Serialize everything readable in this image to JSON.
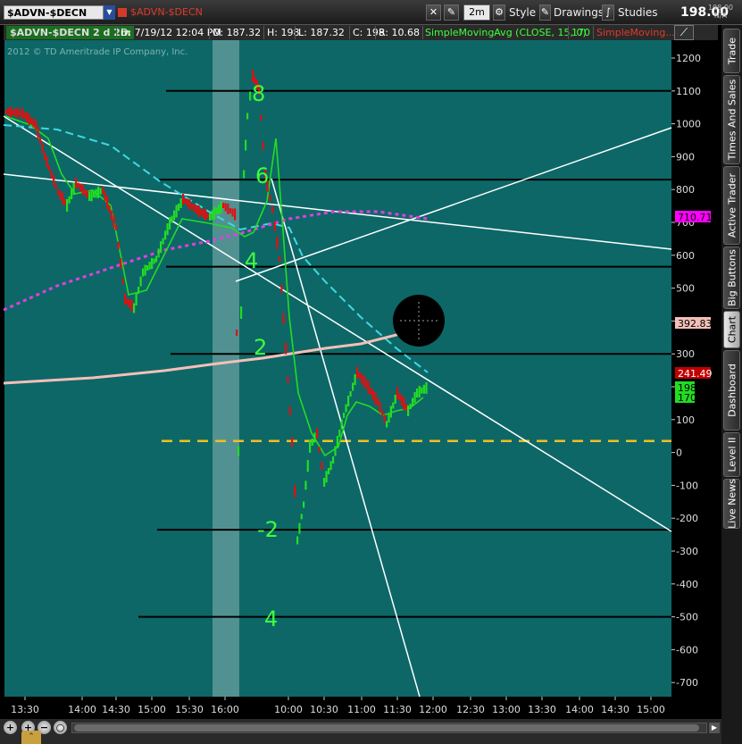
{
  "toolbar": {
    "symbol": "$ADVN-$DECN",
    "title_symbol": "$ADVN-$DECN",
    "timeframe": "2m",
    "style": "Style",
    "drawings": "Drawings",
    "studies": "Studies",
    "last_price": "198.00",
    "last_price_small": "198.00",
    "last_price_na": "N/A"
  },
  "infobar": {
    "symbol_period": "$ADVN-$DECN 2 d 2m",
    "datetime": "D: 7/19/12 12:04 PM",
    "open": "O: 187.32",
    "high": "H: 198",
    "low": "L: 187.32",
    "close": "C: 198",
    "range": "R: 10.68",
    "study": "SimpleMovingAvg (CLOSE, 15, 0)",
    "study_value": "170",
    "study2": "SimpleMoving..."
  },
  "chart": {
    "watermark": "2012 © TD Ameritrade IP Company, Inc.",
    "background": "#0d6767",
    "y_ticks": [
      "1200",
      "1100",
      "1000",
      "900",
      "800",
      "700",
      "600",
      "500",
      "400",
      "300",
      "200",
      "100",
      "0",
      "-100",
      "-200",
      "-300",
      "-400",
      "-500",
      "-600",
      "-700"
    ],
    "x_ticks": [
      "13:30",
      "14:00",
      "14:30",
      "15:00",
      "15:30",
      "16:00",
      "10:00",
      "10:30",
      "11:00",
      "11:30",
      "12:00",
      "12:30",
      "13:00",
      "13:30",
      "14:00",
      "14:30",
      "15:00"
    ],
    "price_tags": [
      {
        "label": "710.71",
        "bg": "#ff00ff",
        "fg": "#000000"
      },
      {
        "label": "392.83",
        "bg": "#f3c0b8",
        "fg": "#000000"
      },
      {
        "label": "241.49",
        "bg": "#c00000",
        "fg": "#ffffff"
      },
      {
        "label": "198",
        "bg": "#22dd22",
        "fg": "#000000"
      },
      {
        "label": "170",
        "bg": "#22dd22",
        "fg": "#000000"
      }
    ],
    "annotations": [
      "8",
      "6",
      "4",
      "2",
      "-2",
      "4"
    ]
  },
  "sidetabs": [
    "Trade",
    "Times And Sales",
    "Active Trader",
    "Big Buttons",
    "Chart",
    "Dashboard",
    "Level II",
    "Live News"
  ],
  "colors": {
    "up": "#22dd22",
    "down": "#e01010",
    "sma_fast": "#22dd22",
    "sma_cyan": "#40d8e0",
    "sma_magenta": "#e040e0",
    "sma_pink": "#f3c0b8",
    "hline": "#000000",
    "dashed": "#f0c020",
    "trend": "#ffffff"
  }
}
